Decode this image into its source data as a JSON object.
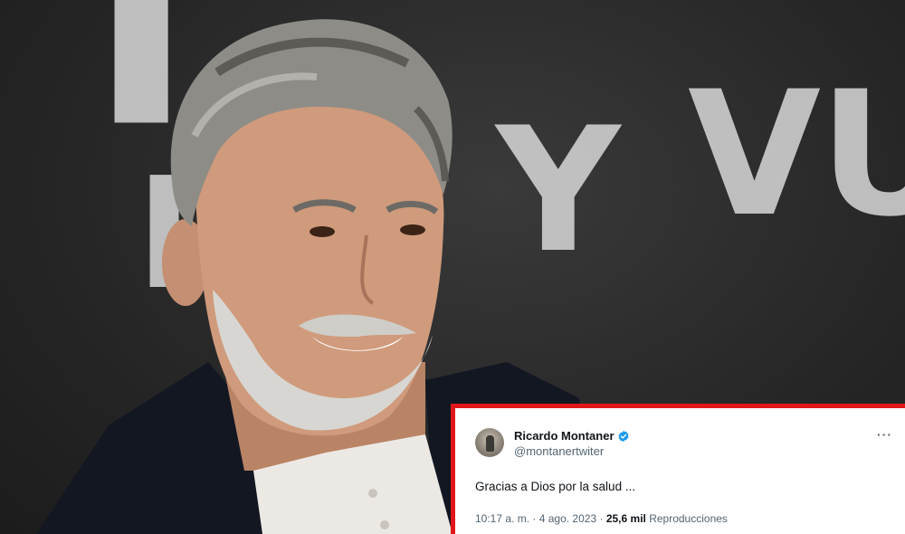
{
  "background": {
    "scene": "smiling-man-portrait",
    "backdrop_letters": [
      "I",
      "Y",
      "V",
      "U"
    ]
  },
  "tweet": {
    "author_name": "Ricardo Montaner",
    "author_handle": "@montanertwiter",
    "verified_icon": "verified-badge-icon",
    "more_icon": "more-options-icon",
    "more_glyph": "···",
    "text": "Gracias a Dios por la salud ...",
    "time": "10:17 a. m.",
    "separator": "·",
    "date": "4 ago. 2023",
    "views_count": "25,6 mil",
    "views_label": "Reproducciones"
  },
  "colors": {
    "frame_red": "#e0161b",
    "verified_blue": "#1d9bf0",
    "text_primary": "#0f1419",
    "text_secondary": "#536471"
  }
}
